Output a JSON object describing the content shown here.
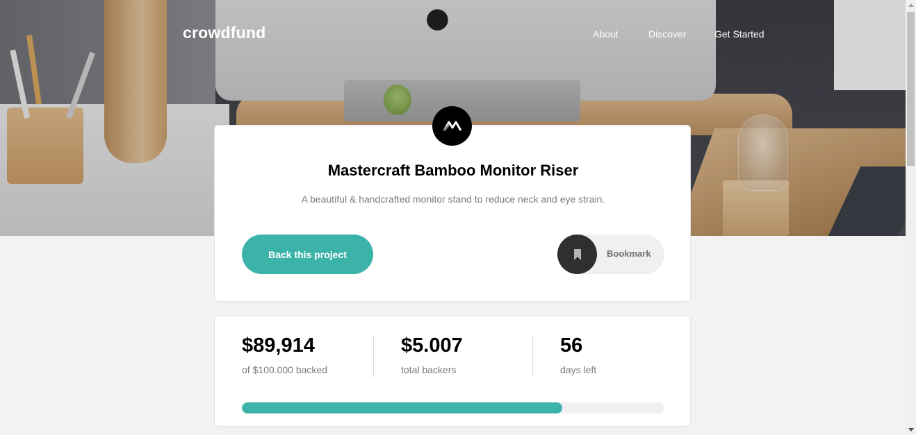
{
  "header": {
    "brand": "crowdfund",
    "nav": [
      {
        "label": "About"
      },
      {
        "label": "Discover"
      },
      {
        "label": "Get Started"
      }
    ]
  },
  "project": {
    "title": "Mastercraft Bamboo Monitor Riser",
    "description": "A beautiful & handcrafted monitor stand to reduce neck and eye strain.",
    "back_label": "Back this project",
    "bookmark_label": "Bookmark",
    "logo_icon": "mastercraft-logo-icon"
  },
  "stats": [
    {
      "value": "$89,914",
      "label": "of $100.000 backed"
    },
    {
      "value": "$5.007",
      "label": "total backers"
    },
    {
      "value": "56",
      "label": "days left"
    }
  ],
  "progress": {
    "fraction": 0.759
  },
  "colors": {
    "accent": "#3cb3a9",
    "dark": "#2f2f2f",
    "background": "#f2f2f2",
    "muted_text": "#7a7a7a"
  }
}
